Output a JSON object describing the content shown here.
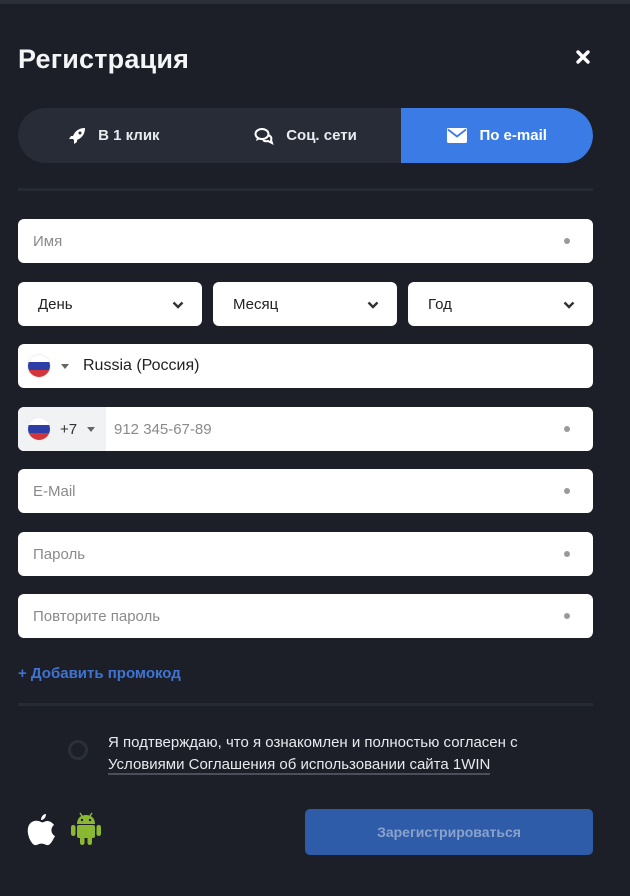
{
  "header": {
    "title": "Регистрация",
    "close_icon": "close-icon"
  },
  "tabs": [
    {
      "label": "В 1 клик",
      "icon": "rocket-icon",
      "active": false
    },
    {
      "label": "Соц. сети",
      "icon": "chat-bubbles-icon",
      "active": false
    },
    {
      "label": "По e-mail",
      "icon": "envelope-icon",
      "active": true
    }
  ],
  "form": {
    "name": {
      "placeholder": "Имя",
      "value": ""
    },
    "birthdate": {
      "day": {
        "label": "День"
      },
      "month": {
        "label": "Месяц"
      },
      "year": {
        "label": "Год"
      }
    },
    "country": {
      "value": "Russia (Россия)",
      "flag": "ru-flag"
    },
    "phone": {
      "code": "+7",
      "placeholder": "912 345-67-89",
      "value": "",
      "flag": "ru-flag"
    },
    "email": {
      "placeholder": "E-Mail",
      "value": ""
    },
    "password": {
      "placeholder": "Пароль",
      "value": ""
    },
    "password_repeat": {
      "placeholder": "Повторите пароль",
      "value": ""
    }
  },
  "promo": {
    "label": "+ Добавить промокод"
  },
  "agreement": {
    "text": "Я подтверждаю, что я ознакомлен и полностью согласен с",
    "link": "Условиями Соглашения об использовании сайта 1WIN",
    "checked": false
  },
  "apps": [
    {
      "name": "apple-icon"
    },
    {
      "name": "android-icon"
    }
  ],
  "register_button": {
    "label": "Зарегистрироваться"
  },
  "colors": {
    "background": "#1c1f27",
    "tab_bar": "#272c37",
    "accent": "#3b7be5",
    "promo_link": "#3f74d4",
    "register_button": "#2f5ca8",
    "android_green": "#8ab833"
  }
}
